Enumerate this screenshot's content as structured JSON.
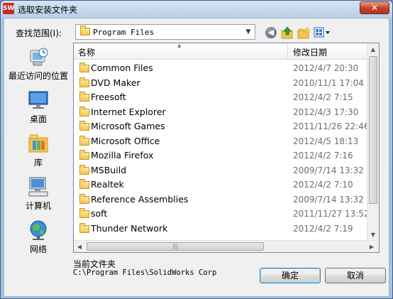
{
  "window": {
    "title": "选取安装文件夹",
    "app_icon_text": "SW",
    "close_label": "✕"
  },
  "toolbar": {
    "look_in_label": "查找范围(I):",
    "look_in_value": "Program Files",
    "back_icon": "back-arrow-icon",
    "up_icon": "up-folder-icon",
    "new_folder_icon": "new-folder-icon",
    "view_icon": "view-menu-icon"
  },
  "places": [
    {
      "label": "最近访问的位置",
      "icon": "recent-places-icon"
    },
    {
      "label": "桌面",
      "icon": "desktop-icon"
    },
    {
      "label": "库",
      "icon": "libraries-icon"
    },
    {
      "label": "计算机",
      "icon": "computer-icon"
    },
    {
      "label": "网络",
      "icon": "network-icon"
    }
  ],
  "list": {
    "columns": {
      "name": "名称",
      "date": "修改日期"
    },
    "rows": [
      {
        "name": "Common Files",
        "date": "2012/4/7 20:30"
      },
      {
        "name": "DVD Maker",
        "date": "2010/11/1 17:04"
      },
      {
        "name": "Freesoft",
        "date": "2012/4/2 7:15"
      },
      {
        "name": "Internet Explorer",
        "date": "2012/4/3 17:30"
      },
      {
        "name": "Microsoft Games",
        "date": "2011/11/26 22:46"
      },
      {
        "name": "Microsoft Office",
        "date": "2012/4/5 18:13"
      },
      {
        "name": "Mozilla Firefox",
        "date": "2012/4/2 7:16"
      },
      {
        "name": "MSBuild",
        "date": "2009/7/14 13:32"
      },
      {
        "name": "Realtek",
        "date": "2012/4/2 7:10"
      },
      {
        "name": "Reference Assemblies",
        "date": "2009/7/14 13:32"
      },
      {
        "name": "soft",
        "date": "2011/11/27 13:52"
      },
      {
        "name": "Thunder Network",
        "date": "2012/4/2 7:19"
      }
    ]
  },
  "current_folder": {
    "label": "当前文件夹",
    "path": "C:\\Program Files\\SolidWorks Corp"
  },
  "buttons": {
    "ok": "确定",
    "cancel": "取消"
  }
}
